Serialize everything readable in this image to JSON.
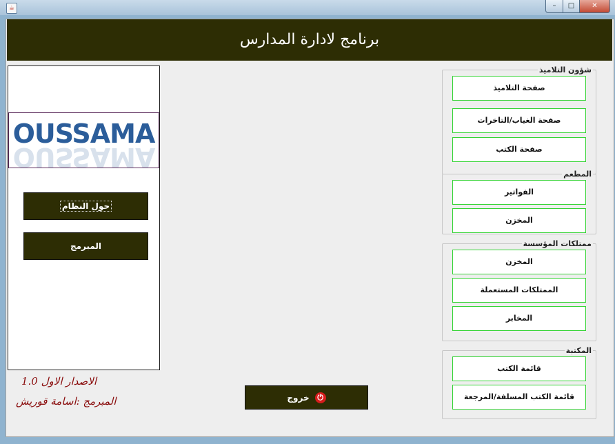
{
  "window": {
    "icon": "java-app-icon",
    "minimize_symbol": "–",
    "maximize_symbol": "□",
    "close_symbol": "✕"
  },
  "header": {
    "title": "برنامج لادارة المدارس"
  },
  "sidebar": {
    "logo_text": "OUSSAMA",
    "about_label": "حول النظام",
    "developer_label": "المبرمج",
    "version_text": "الاصدار الاول 1.0",
    "developer_text": "المبرمج :اسامة قوريش"
  },
  "exit": {
    "label": "خروج",
    "icon_symbol": "⏻"
  },
  "groups": {
    "students": {
      "title": "شؤون التلاميذ",
      "buttons": [
        "صفحة التلاميذ",
        "صفحة الغياب/التاخرات",
        "صفحة الكتب"
      ]
    },
    "restaurant": {
      "title": "المطعم",
      "buttons": [
        "الفواتير",
        "المخزن"
      ]
    },
    "property": {
      "title": "ممتلكات المؤسسة",
      "buttons": [
        "المخزن",
        "الممتلكات المستعملة",
        "المخابر"
      ]
    },
    "library": {
      "title": "المكتبة",
      "buttons": [
        "قائمة الكتب",
        "قائمة الكتب المسلفة/المرجعة"
      ]
    }
  },
  "colors": {
    "banner": "#2d2d04",
    "button_border": "#35d435",
    "signature": "#8a0d0d",
    "exit_icon": "#d61c1c"
  }
}
